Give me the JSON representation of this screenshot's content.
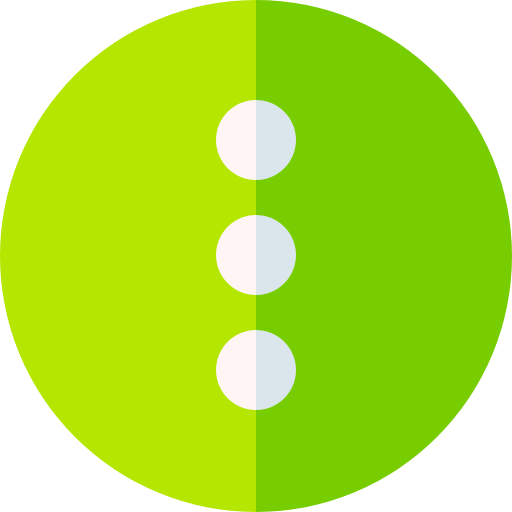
{
  "icon": {
    "name": "more-vertical-icon",
    "colors": {
      "circle_left": "#B4E600",
      "circle_right": "#78CD00",
      "dot_left": "#FFF5F5",
      "dot_right": "#DAE6EB"
    },
    "dot_count": 3
  }
}
